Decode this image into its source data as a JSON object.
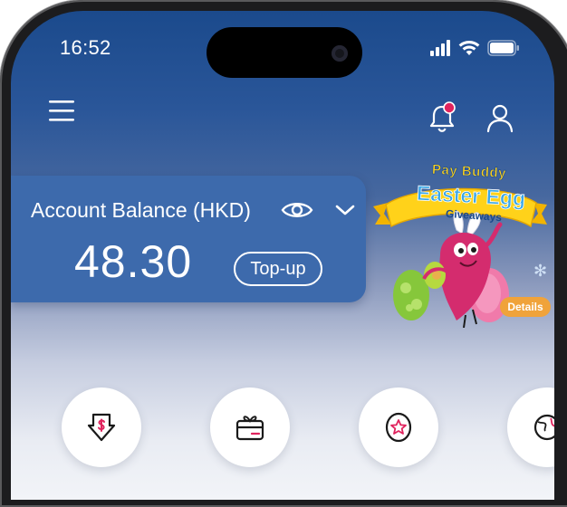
{
  "status_bar": {
    "time": "16:52",
    "icons": [
      "signal-icon",
      "wifi-icon",
      "battery-icon"
    ]
  },
  "header": {
    "icons": [
      "menu-icon",
      "notification-bell-icon",
      "user-profile-icon"
    ],
    "notification_dot_color": "#e0245e"
  },
  "balance": {
    "label": "Account Balance (HKD)",
    "amount": "48.30",
    "topup_label": "Top-up",
    "icons": [
      "eye-icon",
      "chevron-down-icon"
    ]
  },
  "promo": {
    "line1": "Pay Buddy",
    "line2": "Easter Egg",
    "line3": "Giveaways",
    "details_label": "Details"
  },
  "quick_actions": [
    {
      "icon": "receive-money-icon"
    },
    {
      "icon": "gift-card-icon"
    },
    {
      "icon": "star-badge-icon"
    },
    {
      "icon": "globe-icon"
    }
  ],
  "colors": {
    "brand_blue": "#1b4a8c",
    "card_blue": "#3d6aac",
    "accent_pink": "#e0245e",
    "promo_yellow": "#ffd21a",
    "details_orange": "#f0a33a"
  }
}
